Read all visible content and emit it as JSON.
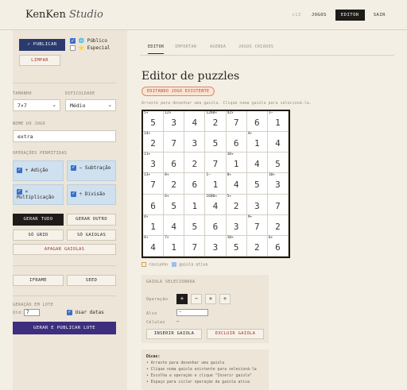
{
  "header": {
    "brand": "KenKen",
    "brand_italic": "Studio",
    "version": "v13",
    "nav": [
      "JOGOS",
      "EDITOR",
      "SAIR"
    ]
  },
  "sidebar": {
    "publish_label": "✓ PUBLICAR",
    "public_label": "🌐 Público",
    "special_label": "⭐ Especial",
    "clear_label": "LIMPAR",
    "size_label": "TAMANHO",
    "difficulty_label": "DIFICULDADE",
    "size_value": "7×7",
    "difficulty_value": "Médio",
    "name_label": "NOME DO JOGO",
    "name_value": "extra",
    "ops_label": "OPERAÇÕES PERMITIDAS",
    "ops": [
      "+ Adição",
      "− Subtração",
      "× Multiplicação",
      "÷ Divisão"
    ],
    "generate_all": "GERAR TUDO",
    "generate_other": "GERAR OUTRO",
    "only_grid": "SÓ GRID",
    "only_cages": "SÓ GAIOLAS",
    "delete_cages": "APAGAR GAIOLAS",
    "iframe": "IFRAME",
    "seed": "SEED",
    "batch_label": "GERAÇÃO EM LOTE",
    "qty_label": "Qtd:",
    "qty_value": "7",
    "use_dates": "Usar datas",
    "batch_button": "GERAR E PUBLICAR LOTE"
  },
  "main": {
    "tabs": [
      "EDITOR",
      "IMPORTAR",
      "AGENDA",
      "JOGOS CRIADOS"
    ],
    "title": "Editor de puzzles",
    "badge": "EDITANDO JOGO EXISTENTE",
    "hint": "Arraste para desenhar uma gaiola. Clique numa gaiola para selecioná-la.",
    "legend_draft": "rascunho",
    "legend_active": "gaiola ativa"
  },
  "grid": {
    "size": 7,
    "values": [
      [
        5,
        3,
        4,
        2,
        7,
        6,
        1
      ],
      [
        2,
        7,
        3,
        5,
        6,
        1,
        4
      ],
      [
        3,
        6,
        2,
        7,
        1,
        4,
        5
      ],
      [
        7,
        2,
        6,
        1,
        4,
        5,
        3
      ],
      [
        6,
        5,
        1,
        4,
        2,
        3,
        7
      ],
      [
        1,
        4,
        5,
        6,
        3,
        7,
        2
      ],
      [
        4,
        1,
        7,
        3,
        5,
        2,
        6
      ]
    ],
    "clues": [
      [
        "5+",
        "12×",
        "",
        "1260×",
        "42×",
        "",
        "1−"
      ],
      [
        "14×",
        "",
        "",
        "",
        "",
        "4+",
        ""
      ],
      [
        "11+",
        "",
        "",
        "",
        "10+",
        "",
        ""
      ],
      [
        "13+",
        "8+",
        "",
        "1−",
        "8+",
        "",
        "10+"
      ],
      [
        "",
        "6+",
        "",
        "1680×",
        "5+",
        "",
        ""
      ],
      [
        "4×",
        "",
        "",
        "",
        "",
        "9+",
        ""
      ],
      [
        "4+",
        "7×",
        "",
        "",
        "10×",
        "",
        "6+"
      ]
    ]
  },
  "cage_panel": {
    "title": "GAIOLA SELECIONADA",
    "operation_label": "Operação",
    "ops": [
      "+",
      "−",
      "×",
      "÷"
    ],
    "target_label": "Alvo",
    "target_value": "—",
    "cells_label": "Células",
    "cells_value": "—",
    "insert_button": "INSERIR GAIOLA",
    "delete_button": "EXCLUIR GAIOLA"
  },
  "tips": {
    "title": "Dicas:",
    "items": [
      "• Arraste para desenhar uma gaiola",
      "• Clique numa gaiola existente para selecioná-la",
      "• Escolha a operação e clique \"Inserir gaiola\"",
      "• Espaço para ciclar operação da gaiola ativa"
    ]
  }
}
